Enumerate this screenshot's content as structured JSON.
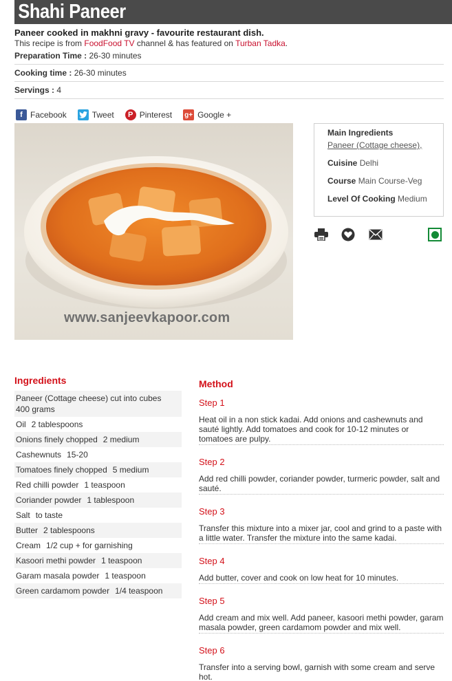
{
  "recipe": {
    "title": "Shahi Paneer",
    "subtitle": "Paneer cooked in makhni gravy - favourite restaurant dish.",
    "source": {
      "prefix": "This recipe is from ",
      "channel": "FoodFood TV",
      "middle": " channel & has featured on ",
      "show": "Turban Tadka",
      "suffix": "."
    },
    "meta": [
      {
        "label": "Preparation Time :",
        "value": "26-30 minutes"
      },
      {
        "label": "Cooking time :",
        "value": "26-30 minutes"
      },
      {
        "label": "Servings :",
        "value": "4"
      }
    ]
  },
  "social": [
    {
      "label": "Facebook",
      "icon": "facebook-icon"
    },
    {
      "label": "Tweet",
      "icon": "twitter-icon"
    },
    {
      "label": "Pinterest",
      "icon": "pinterest-icon"
    },
    {
      "label": "Google +",
      "icon": "google-plus-icon"
    }
  ],
  "photo": {
    "watermark": "www.sanjeevkapoor.com"
  },
  "info": {
    "main_ingredients_label": "Main Ingredients",
    "main_ingredients_value": "Paneer (Cottage cheese),",
    "cuisine_label": "Cuisine",
    "cuisine_value": "Delhi",
    "course_label": "Course",
    "course_value": "Main Course-Veg",
    "level_label": "Level Of Cooking",
    "level_value": "Medium"
  },
  "actions": [
    "print-icon",
    "favourite-heart-icon",
    "email-envelope-icon",
    "veg-indicator-icon"
  ],
  "ingredients": {
    "title": "Ingredients",
    "items": [
      {
        "name": "Paneer (Cottage cheese) cut into cubes",
        "qty": "400 grams",
        "wrap": true
      },
      {
        "name": "Oil",
        "qty": "2 tablespoons"
      },
      {
        "name": "Onions finely chopped",
        "qty": "2 medium"
      },
      {
        "name": "Cashewnuts",
        "qty": "15-20"
      },
      {
        "name": "Tomatoes finely chopped",
        "qty": "5 medium"
      },
      {
        "name": "Red chilli powder",
        "qty": "1 teaspoon"
      },
      {
        "name": "Coriander powder",
        "qty": "1 tablespoon"
      },
      {
        "name": "Salt",
        "qty": "to taste"
      },
      {
        "name": "Butter",
        "qty": "2 tablespoons"
      },
      {
        "name": "Cream",
        "qty": "1/2 cup + for garnishing"
      },
      {
        "name": "Kasoori methi powder",
        "qty": "1 teaspoon"
      },
      {
        "name": "Garam masala powder",
        "qty": "1 teaspoon"
      },
      {
        "name": "Green cardamom powder",
        "qty": "1/4 teaspoon"
      }
    ]
  },
  "method": {
    "title": "Method",
    "steps": [
      {
        "label": "Step 1",
        "text": "Heat oil in a non stick kadai. Add onions and cashewnuts and sauté lightly. Add tomatoes and cook for 10-12 minutes or tomatoes are pulpy."
      },
      {
        "label": "Step 2",
        "text": "Add red chilli powder, coriander powder, turmeric powder, salt and sauté."
      },
      {
        "label": "Step 3",
        "text": "Transfer this mixture into a mixer jar, cool and grind to a paste with a little water. Transfer the mixture into the same kadai."
      },
      {
        "label": "Step 4",
        "text": "Add butter, cover and cook on low heat for 10 minutes."
      },
      {
        "label": "Step 5",
        "text": "Add cream and mix well. Add paneer, kasoori methi powder, garam masala powder, green cardamom powder and mix well."
      },
      {
        "label": "Step 6",
        "text": "Transfer into a serving bowl, garnish with some cream and serve hot."
      }
    ]
  },
  "colors": {
    "accent_red": "#d3111a",
    "title_bar": "#4a4a4a",
    "veg_green": "#138a36"
  }
}
